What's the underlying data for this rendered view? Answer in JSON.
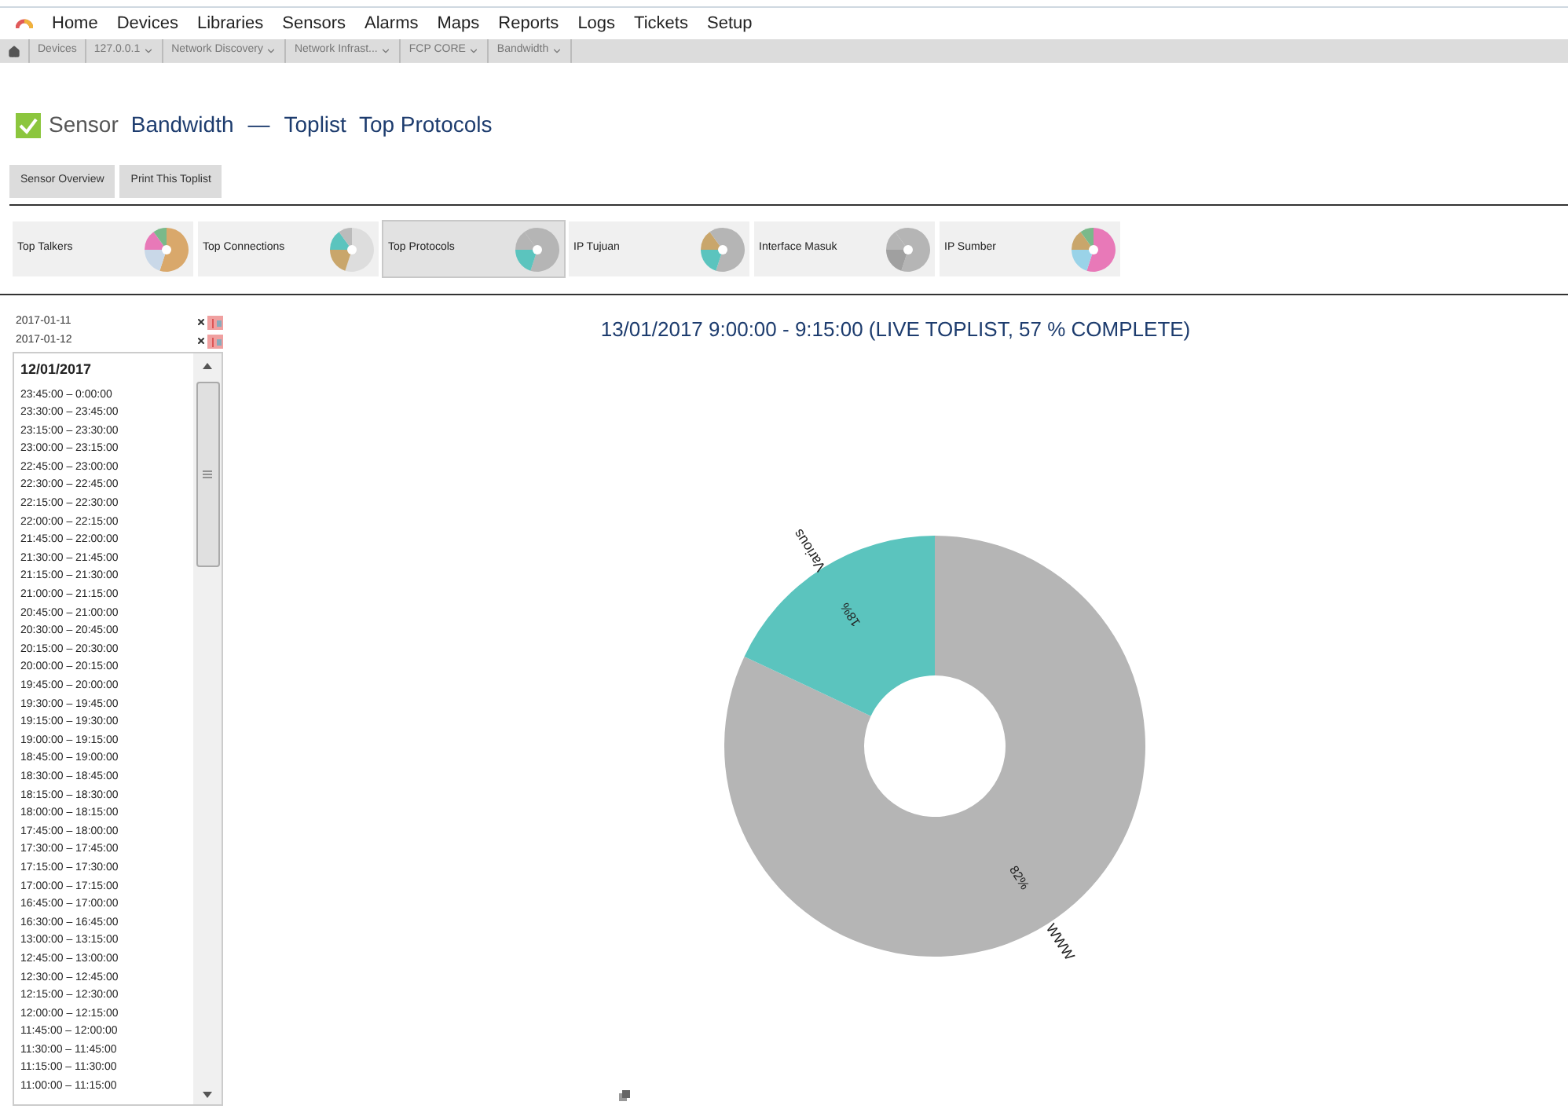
{
  "menu": {
    "items": [
      "Home",
      "Devices",
      "Libraries",
      "Sensors",
      "Alarms",
      "Maps",
      "Reports",
      "Logs",
      "Tickets",
      "Setup"
    ]
  },
  "breadcrumb": [
    {
      "label": "Devices",
      "dropdown": false
    },
    {
      "label": "127.0.0.1",
      "dropdown": true
    },
    {
      "label": "Network Discovery",
      "dropdown": true
    },
    {
      "label": "Network Infrast...",
      "dropdown": true
    },
    {
      "label": "FCP CORE",
      "dropdown": true
    },
    {
      "label": "Bandwidth",
      "dropdown": true
    }
  ],
  "header": {
    "sensor_label": "Sensor",
    "sensor_name": "Bandwidth",
    "separator": "—",
    "toplist_label": "Toplist",
    "toplist_name": "Top Protocols"
  },
  "buttons": [
    "Sensor Overview",
    "Print This Toplist"
  ],
  "toplists": [
    {
      "label": "Top Talkers",
      "selected": false
    },
    {
      "label": "Top Connections",
      "selected": false
    },
    {
      "label": "Top Protocols",
      "selected": true
    },
    {
      "label": "IP Tujuan",
      "selected": false
    },
    {
      "label": "Interface Masuk",
      "selected": false
    },
    {
      "label": "IP Sumber",
      "selected": false
    }
  ],
  "dates": [
    "2017-01-11",
    "2017-01-12"
  ],
  "time_list": {
    "date": "12/01/2017",
    "items": [
      "23:45:00 – 0:00:00",
      "23:30:00 – 23:45:00",
      "23:15:00 – 23:30:00",
      "23:00:00 – 23:15:00",
      "22:45:00 – 23:00:00",
      "22:30:00 – 22:45:00",
      "22:15:00 – 22:30:00",
      "22:00:00 – 22:15:00",
      "21:45:00 – 22:00:00",
      "21:30:00 – 21:45:00",
      "21:15:00 – 21:30:00",
      "21:00:00 – 21:15:00",
      "20:45:00 – 21:00:00",
      "20:30:00 – 20:45:00",
      "20:15:00 – 20:30:00",
      "20:00:00 – 20:15:00",
      "19:45:00 – 20:00:00",
      "19:30:00 – 19:45:00",
      "19:15:00 – 19:30:00",
      "19:00:00 – 19:15:00",
      "18:45:00 – 19:00:00",
      "18:30:00 – 18:45:00",
      "18:15:00 – 18:30:00",
      "18:00:00 – 18:15:00",
      "17:45:00 – 18:00:00",
      "17:30:00 – 17:45:00",
      "17:15:00 – 17:30:00",
      "17:00:00 – 17:15:00",
      "16:45:00 – 17:00:00",
      "16:30:00 – 16:45:00",
      "13:00:00 – 13:15:00",
      "12:45:00 – 13:00:00",
      "12:30:00 – 12:45:00",
      "12:15:00 – 12:30:00",
      "12:00:00 – 12:15:00",
      "11:45:00 – 12:00:00",
      "11:30:00 – 11:45:00",
      "11:15:00 – 11:30:00",
      "11:00:00 – 11:15:00"
    ]
  },
  "main": {
    "chart_data": {
      "type": "donut",
      "title": "13/01/2017 9:00:00 - 9:15:00 (LIVE TOPLIST, 57 % COMPLETE)",
      "categories": [
        "WWW",
        "Various"
      ],
      "values": [
        82,
        18
      ],
      "colors": [
        "#b5b5b5",
        "#5bc4be"
      ],
      "value_labels": [
        "82%",
        "18%"
      ]
    }
  }
}
